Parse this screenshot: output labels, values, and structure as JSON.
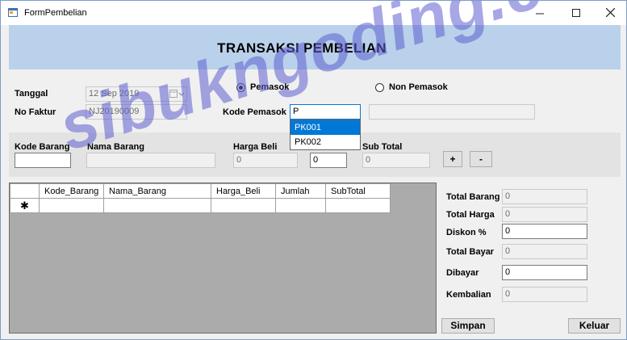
{
  "window": {
    "title": "FormPembelian"
  },
  "header": {
    "title": "TRANSAKSI PEMBELIAN"
  },
  "form": {
    "tanggal_label": "Tanggal",
    "tanggal_value": "12 Sep 2019",
    "no_faktur_label": "No Faktur",
    "no_faktur_value": "NJ20190009",
    "radio_pemasok": "Pemasok",
    "radio_non_pemasok": "Non Pemasok",
    "kode_pemasok_label": "Kode Pemasok",
    "kode_pemasok_value": "P",
    "kode_pemasok_options": [
      "PK001",
      "PK002"
    ],
    "nama_pemasok_value": ""
  },
  "item_entry": {
    "kode_barang_label": "Kode Barang",
    "nama_barang_label": "Nama Barang",
    "harga_beli_label": "Harga Beli",
    "sub_total_label": "Sub Total",
    "kode_barang_value": "",
    "nama_barang_value": "",
    "harga_beli_value": "0",
    "jumlah_value": "0",
    "sub_total_value": "0",
    "add_label": "+",
    "remove_label": "-"
  },
  "grid": {
    "columns": [
      "Kode_Barang",
      "Nama_Barang",
      "Harga_Beli",
      "Jumlah",
      "SubTotal"
    ],
    "new_row_marker": "✱"
  },
  "summary": {
    "total_barang_label": "Total Barang",
    "total_barang_value": "0",
    "total_harga_label": "Total Harga",
    "total_harga_value": "0",
    "diskon_label": "Diskon %",
    "diskon_value": "0",
    "total_bayar_label": "Total Bayar",
    "total_bayar_value": "0",
    "dibayar_label": "Dibayar",
    "dibayar_value": "0",
    "kembalian_label": "Kembalian",
    "kembalian_value": "0"
  },
  "buttons": {
    "simpan": "Simpan",
    "keluar": "Keluar"
  },
  "watermark": "sibukngoding.com",
  "colors": {
    "header_bg": "#b9d1ea",
    "selection": "#0078d7",
    "watermark": "#5f5fd2"
  }
}
